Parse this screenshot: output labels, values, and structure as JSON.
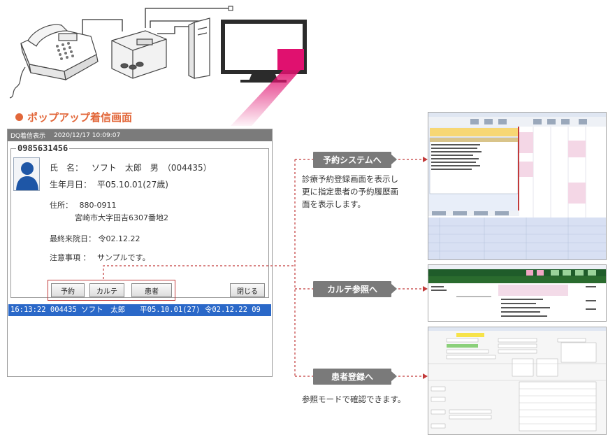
{
  "section_title": "ポップアップ着信画面",
  "popup": {
    "titlebar_name": "DQ着信表示",
    "titlebar_datetime": "2020/12/17 10:09:07",
    "phone_number": "0985631456",
    "name_label": "氏　名：",
    "name_value": "ソフト　太郎　男　（004435）",
    "birth_label": "生年月日：",
    "birth_value": "平05.10.01(27歳)",
    "address_label": "住所：",
    "postal_code": "880-0911",
    "address_value": "宮崎市大字田吉6307番地2",
    "last_visit_label": "最終来院日：",
    "last_visit_value": "令02.12.22",
    "notes_label": "注意事項 ：",
    "notes_value": "サンプルです。",
    "buttons": {
      "reservation": "予約",
      "chart": "カルテ",
      "patient": "患者",
      "close": "閉じる"
    },
    "history_row": "16:13:22 004435 ソフト　太郎　　平05.10.01(27) 令02.12.22 09"
  },
  "callouts": {
    "reservation": "予約システムへ",
    "chart": "カルテ参照へ",
    "patient": "患者登録へ"
  },
  "descriptions": {
    "reservation_lines": [
      "診療予約登録画面を表示し",
      "更に指定患者の予約履歴画",
      "面を表示します。"
    ],
    "patient_line": "参照モードで確認できます。"
  },
  "colors": {
    "accent_orange": "#e2673a",
    "monitor_pink": "#e0116f",
    "selection_blue": "#2a68c8",
    "callout_gray": "#7a7a7a",
    "link_red": "#c23a3a"
  }
}
